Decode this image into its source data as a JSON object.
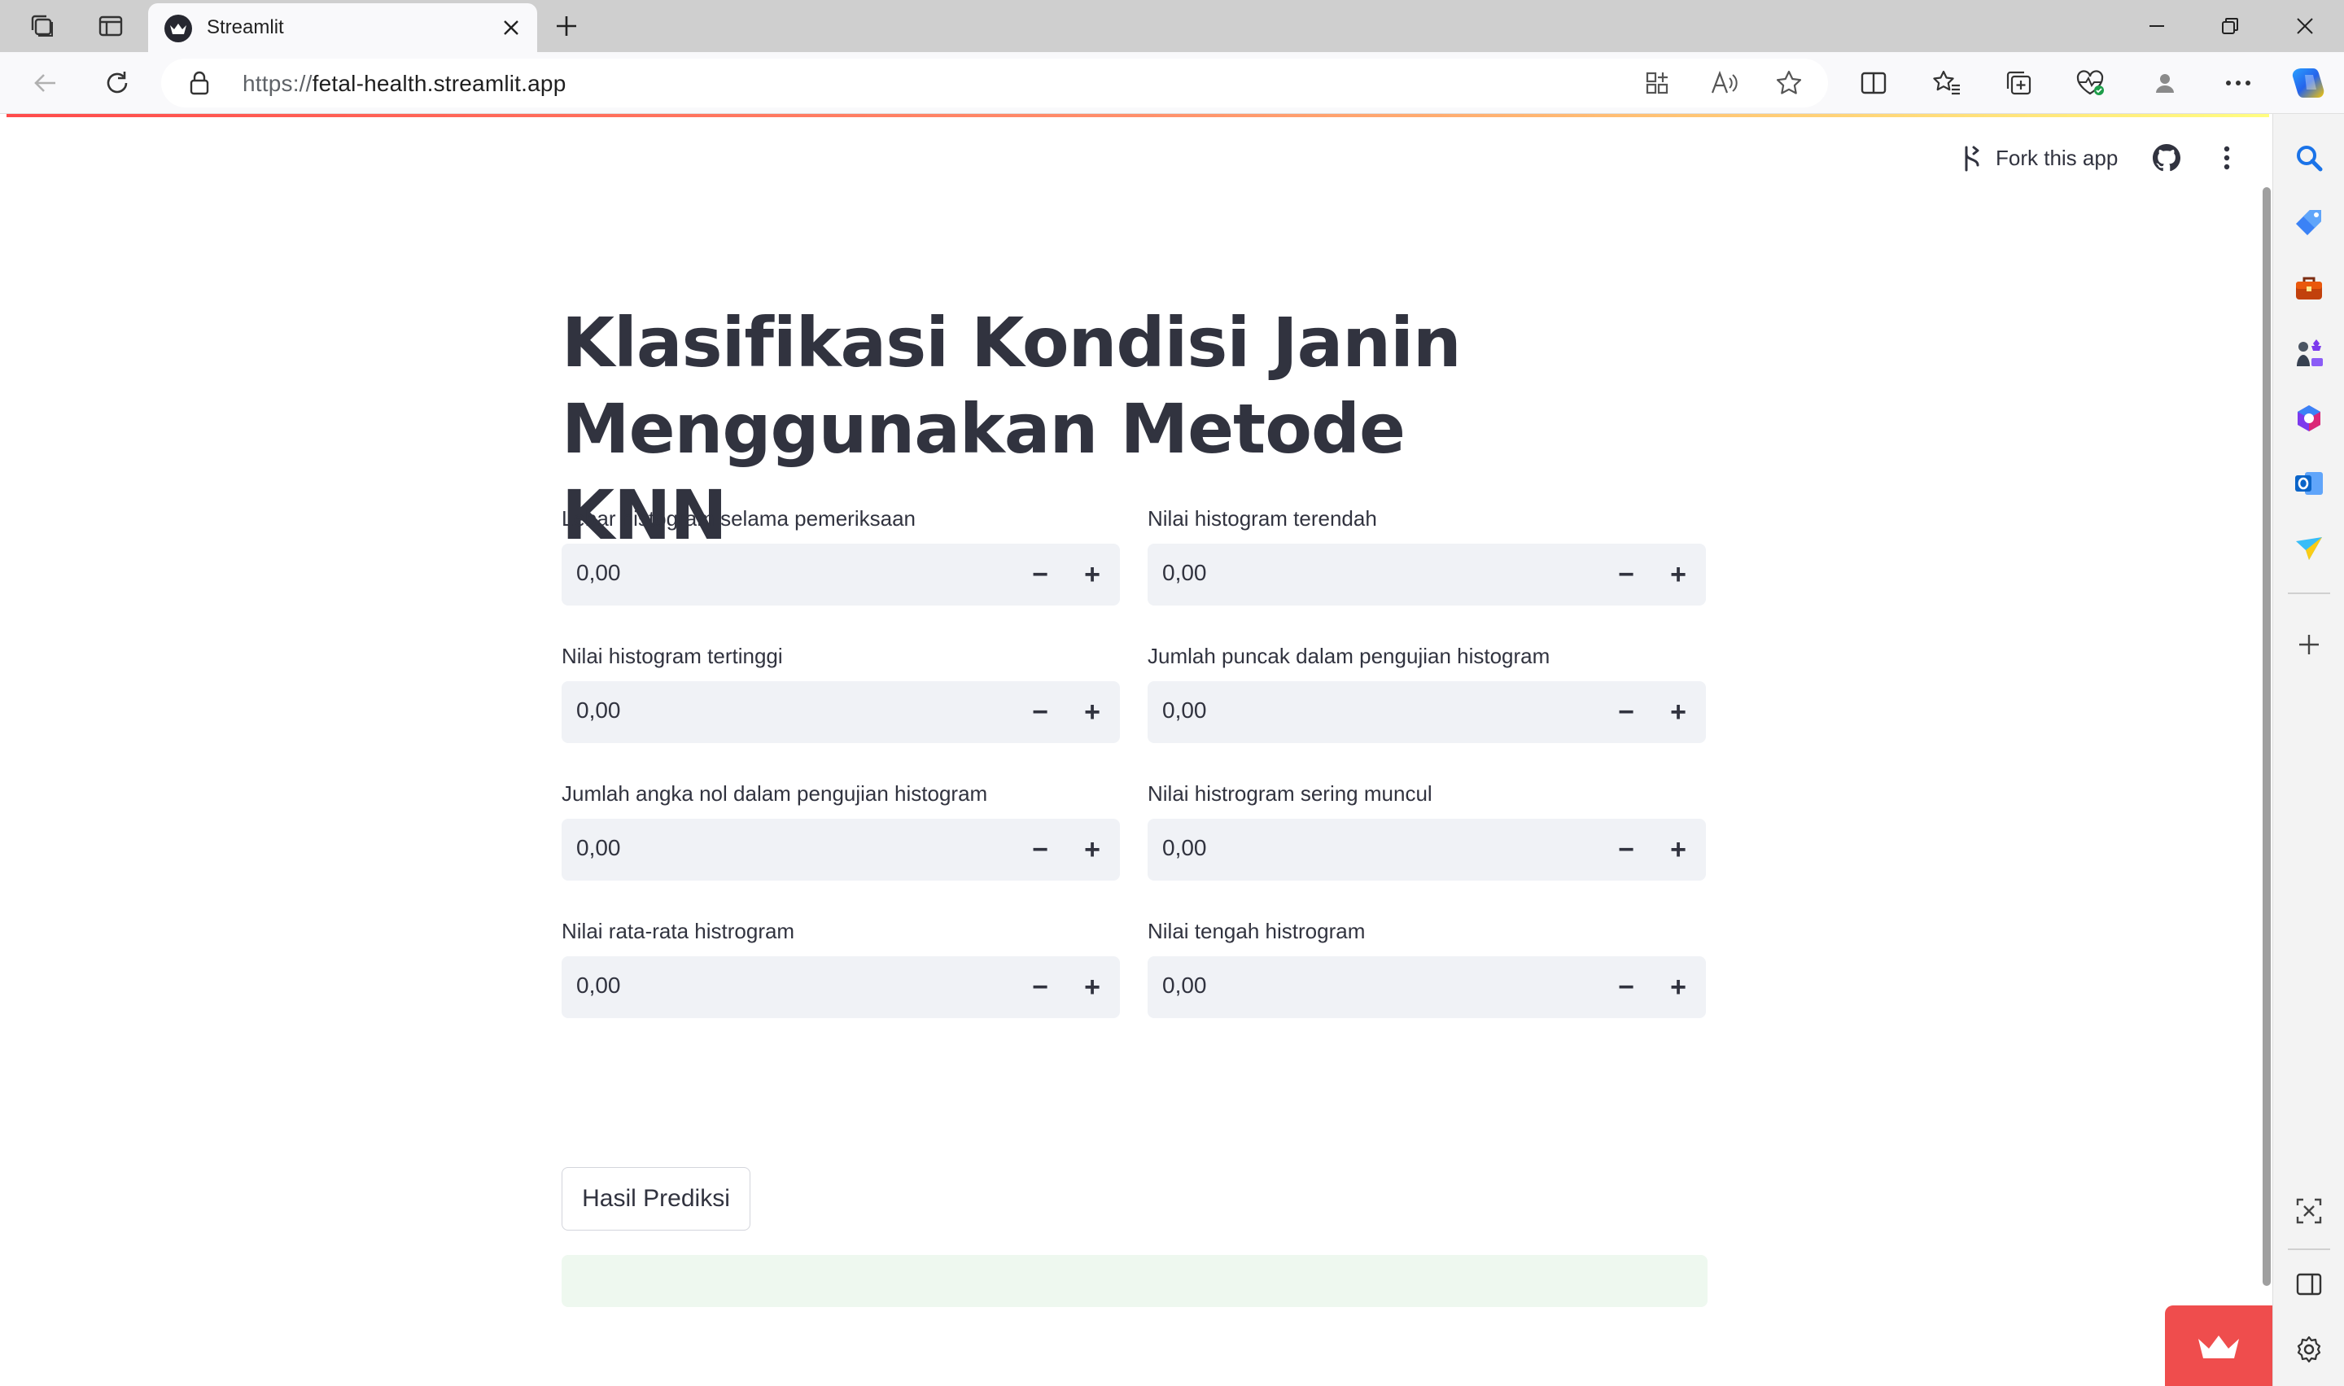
{
  "browser": {
    "tab_title": "Streamlit",
    "url_prefix": "https://",
    "url_host": "fetal-health.streamlit.app",
    "icons": {
      "tab_actions": "tab-actions-icon",
      "vertical_tabs": "vertical-tabs-icon",
      "close_tab": "close-icon",
      "new_tab": "plus-icon",
      "minimize": "minimize-icon",
      "maximize": "restore-icon",
      "close_window": "close-icon",
      "back": "back-arrow-icon",
      "refresh": "refresh-icon",
      "site_info": "lock-icon",
      "app_available": "apps-icon",
      "read_aloud": "read-aloud-icon",
      "favorite": "star-icon",
      "split_screen": "split-screen-icon",
      "favorites": "favorites-icon",
      "collections": "collections-icon",
      "browser_essentials": "heart-pulse-icon",
      "profile": "profile-icon",
      "more": "more-icon",
      "copilot": "copilot-icon"
    }
  },
  "edge_sidebar": {
    "items": [
      "search-icon",
      "shopping-tag-icon",
      "tools-icon",
      "games-icon",
      "microsoft-365-icon",
      "outlook-icon",
      "send-icon",
      "add-icon",
      "screenshot-icon",
      "sidebar-toggle-icon",
      "settings-icon"
    ]
  },
  "app": {
    "fork_label": "Fork this app",
    "title": "Klasifikasi Kondisi Janin Menggunakan Metode KNN",
    "fields": [
      {
        "label": "Lebar histogram selama pemeriksaan",
        "value": "0,00"
      },
      {
        "label": "Nilai histogram terendah",
        "value": "0,00"
      },
      {
        "label": "Nilai histogram tertinggi",
        "value": "0,00"
      },
      {
        "label": "Jumlah puncak dalam pengujian histogram",
        "value": "0,00"
      },
      {
        "label": "Jumlah angka nol dalam pengujian histogram",
        "value": "0,00"
      },
      {
        "label": "Nilai histrogram sering muncul",
        "value": "0,00"
      },
      {
        "label": "Nilai rata-rata histrogram",
        "value": "0,00"
      },
      {
        "label": "Nilai tengah histrogram",
        "value": "0,00"
      }
    ],
    "stepper_minus": "−",
    "stepper_plus": "+",
    "predict_button": "Hasil Prediksi",
    "result_text": ""
  },
  "colors": {
    "accent": "#ff4b4b",
    "input_bg": "#f0f2f6",
    "success_bg": "#eef8ef",
    "text": "#31333f"
  }
}
